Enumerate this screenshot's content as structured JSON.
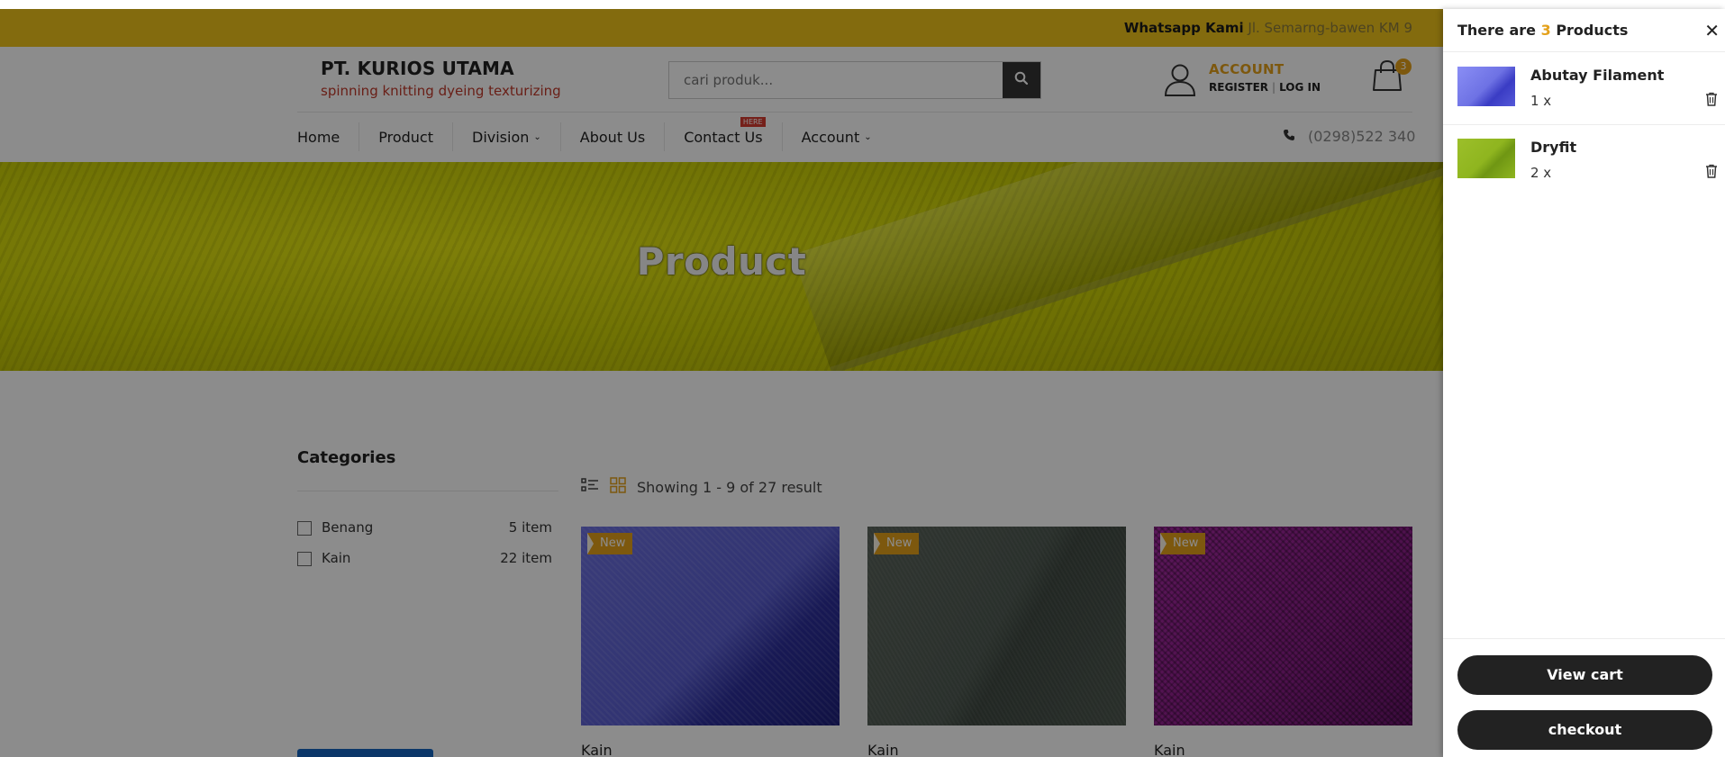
{
  "announce": {
    "label": "Whatsapp Kami",
    "address": "Jl. Semarng-bawen KM 9"
  },
  "brand": {
    "name": "PT. KURIOS UTAMA",
    "tagline": "spinning knitting dyeing texturizing"
  },
  "search": {
    "placeholder": "cari produk...",
    "icon": "search-icon"
  },
  "account": {
    "title": "ACCOUNT",
    "register": "REGISTER",
    "separator": "|",
    "login": "LOG IN"
  },
  "cart": {
    "count": "3"
  },
  "nav": {
    "items": [
      {
        "label": "Home"
      },
      {
        "label": "Product"
      },
      {
        "label": "Division",
        "chevron": "⌄"
      },
      {
        "label": "About Us"
      },
      {
        "label": "Contact Us",
        "badge": "HERE"
      },
      {
        "label": "Account",
        "chevron": "⌄"
      }
    ],
    "phone": "(0298)522 340"
  },
  "hero": {
    "title": "Product"
  },
  "categories": {
    "title": "Categories",
    "items": [
      {
        "label": "Benang",
        "count": "5 item"
      },
      {
        "label": "Kain",
        "count": "22 item"
      }
    ]
  },
  "listing": {
    "result_text": "Showing 1 - 9 of 27 result",
    "products": [
      {
        "badge": "New",
        "category": "Kain",
        "color": "#5a5ed0"
      },
      {
        "badge": "New",
        "category": "Kain",
        "color": "#4d5850"
      },
      {
        "badge": "New",
        "category": "Kain",
        "color": "#8e1f8c"
      }
    ]
  },
  "drawer": {
    "title_prefix": "There are",
    "title_count": "3",
    "title_suffix": "Products",
    "items": [
      {
        "name": "Abutay Filament",
        "qty": "1 x"
      },
      {
        "name": "Dryfit",
        "qty": "2 x"
      }
    ],
    "view_cart": "View cart",
    "checkout": "checkout"
  },
  "colors": {
    "accent": "#e4a11b",
    "announce_bg": "#eec41b",
    "brand_tagline": "#c0392b",
    "dark_button": "#222222"
  }
}
